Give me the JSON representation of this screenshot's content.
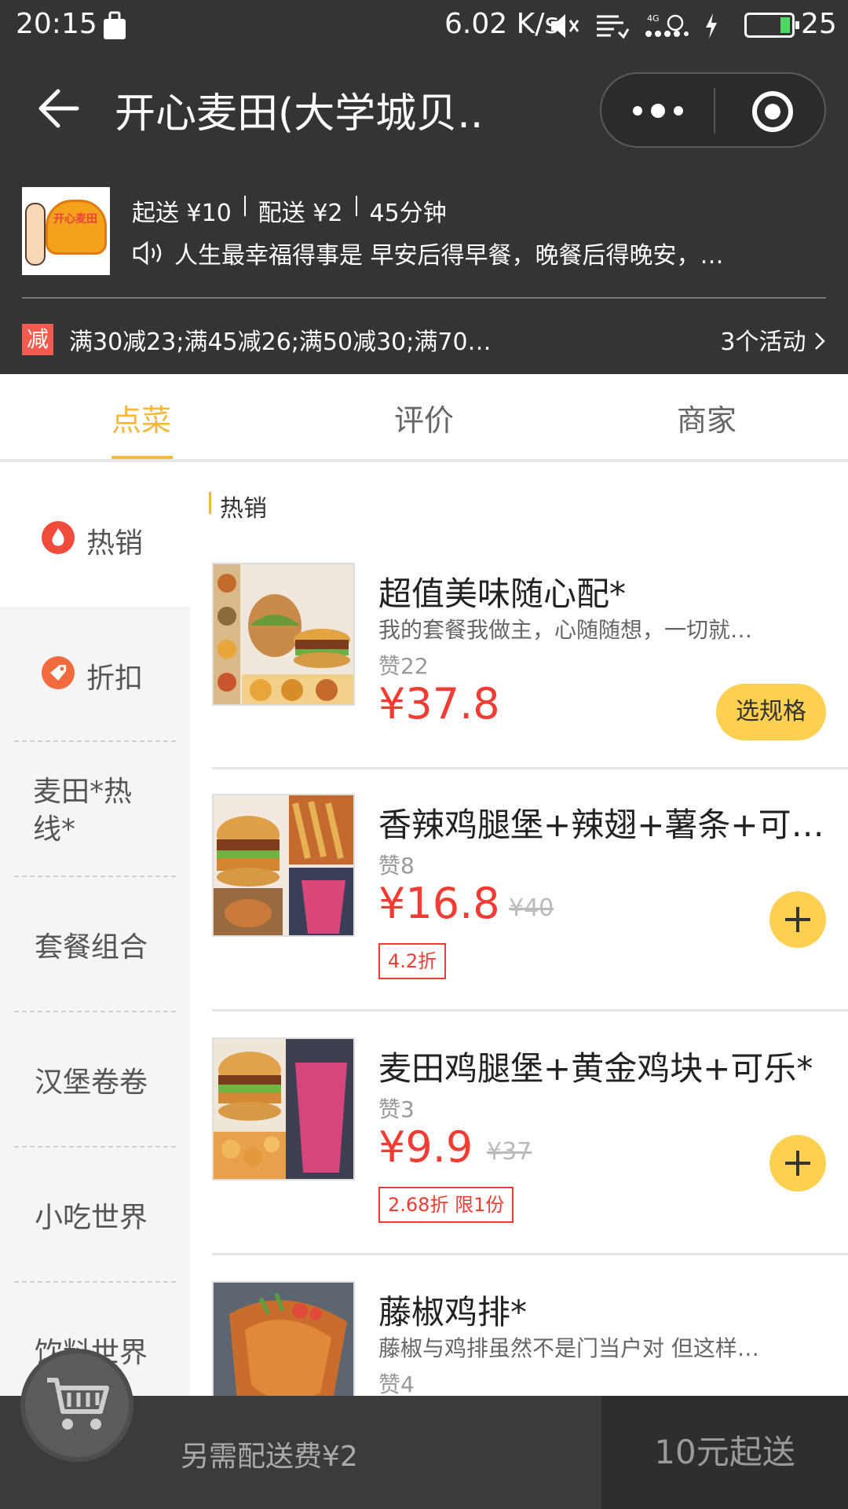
{
  "status_bar": {
    "time": "20:15",
    "speed": "6.02 K/s",
    "battery_level": "25",
    "network": "4G"
  },
  "header": {
    "title": "开心麦田(大学城贝..",
    "back_icon": "arrow-left-icon",
    "more_icon": "more-dots-icon",
    "close_icon": "target-circle-icon"
  },
  "shop": {
    "min_order": "起送 ¥10",
    "delivery_fee": "配送 ¥2",
    "delivery_time": "45分钟",
    "notice": "人生最幸福得事是 早安后得早餐，晚餐后得晚安，…",
    "logo_text": "开心麦田"
  },
  "promo": {
    "badge": "减",
    "text": "满30减23;满45减26;满50减30;满70…",
    "activities": "3个活动"
  },
  "tabs": [
    {
      "label": "点菜",
      "active": true
    },
    {
      "label": "评价",
      "active": false
    },
    {
      "label": "商家",
      "active": false
    }
  ],
  "categories": [
    {
      "label": "热销",
      "active": true
    },
    {
      "label": "折扣",
      "active": false
    },
    {
      "label": "麦田*热线*",
      "line1": "麦田*热",
      "line2": "线*",
      "active": false
    },
    {
      "label": "套餐组合",
      "active": false
    },
    {
      "label": "汉堡卷卷",
      "active": false
    },
    {
      "label": "小吃世界",
      "active": false
    },
    {
      "label": "饮料世界",
      "active": false
    }
  ],
  "section_title": "热销",
  "items": [
    {
      "name": "超值美味随心配*",
      "desc": "我的套餐我做主，心随随想，一切就…",
      "likes": "赞22",
      "price": "¥37.8",
      "action": "选规格"
    },
    {
      "name": "香辣鸡腿堡+辣翅+薯条+可…",
      "likes": "赞8",
      "price": "¥16.8",
      "old_price": "¥40",
      "tag": "4.2折"
    },
    {
      "name": "麦田鸡腿堡+黄金鸡块+可乐*",
      "likes": "赞3",
      "price": "¥9.9",
      "old_price": "¥37",
      "tag": "2.68折 限1份"
    },
    {
      "name": "藤椒鸡排*",
      "desc": "藤椒与鸡排虽然不是门当户对 但这样…",
      "likes": "赞4"
    }
  ],
  "bottom_bar": {
    "fee_text": "另需配送费¥2",
    "min_button": "10元起送",
    "cart_icon": "shopping-cart-icon"
  },
  "colors": {
    "header_bg": "#343434",
    "accent": "#f5b83d",
    "price": "#f03c32",
    "button_yellow": "#fdd052"
  }
}
